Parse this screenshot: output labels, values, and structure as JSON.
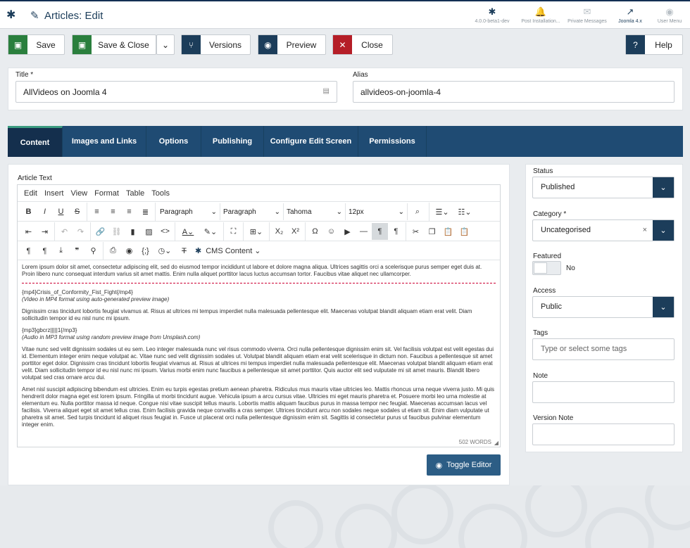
{
  "header": {
    "title": "Articles: Edit",
    "items": [
      {
        "label": "4.0.0-beta1-dev",
        "icon": "joomla-icon"
      },
      {
        "label": "Post Installation...",
        "icon": "bell-icon"
      },
      {
        "label": "Private Messages",
        "icon": "envelope-icon"
      },
      {
        "label": "Joomla 4.x",
        "icon": "external-link-icon"
      },
      {
        "label": "User Menu",
        "icon": "user-icon"
      }
    ]
  },
  "toolbar": {
    "save": "Save",
    "save_close": "Save & Close",
    "versions": "Versions",
    "preview": "Preview",
    "close": "Close",
    "help": "Help"
  },
  "form": {
    "title_label": "Title *",
    "title_value": "AllVideos on Joomla 4",
    "alias_label": "Alias",
    "alias_value": "allvideos-on-joomla-4"
  },
  "tabs": [
    "Content",
    "Images and Links",
    "Options",
    "Publishing",
    "Configure Edit Screen",
    "Permissions"
  ],
  "editor": {
    "label": "Article Text",
    "menu": [
      "Edit",
      "Insert",
      "View",
      "Format",
      "Table",
      "Tools"
    ],
    "selects": [
      "Paragraph",
      "Paragraph",
      "Tahoma",
      "12px"
    ],
    "cms_content": "CMS Content",
    "word_count": "502 WORDS",
    "toggle": "Toggle Editor",
    "paragraphs": [
      "Lorem ipsum dolor sit amet, consectetur adipiscing elit, sed do eiusmod tempor incididunt ut labore et dolore magna aliqua. Ultrices sagittis orci a scelerisque purus semper eget duis at. Proin libero nunc consequat interdum varius sit amet mattis. Enim nulla aliquet porttitor lacus luctus accumsan tortor. Faucibus vitae aliquet nec ullamcorper.",
      "{mp4}Crisis_of_Conformity_Fist_Fight{/mp4}",
      "(Video in MP4 format using auto-generated preview image)",
      "Dignissim cras tincidunt lobortis feugiat vivamus at. Risus at ultrices mi tempus imperdiet nulla malesuada pellentesque elit. Maecenas volutpat blandit aliquam etiam erat velit. Diam sollicitudin tempor id eu nisl nunc mi ipsum.",
      "{mp3}gbcrz|||||1{/mp3}",
      "(Audio in MP3 format using random preview image from Unsplash.com)",
      "Vitae nunc sed velit dignissim sodales ut eu sem. Leo integer malesuada nunc vel risus commodo viverra. Orci nulla pellentesque dignissim enim sit. Vel facilisis volutpat est velit egestas dui id. Elementum integer enim neque volutpat ac. Vitae nunc sed velit dignissim sodales ut. Volutpat blandit aliquam etiam erat velit scelerisque in dictum non. Faucibus a pellentesque sit amet porttitor eget dolor. Dignissim cras tincidunt lobortis feugiat vivamus at. Risus at ultrices mi tempus imperdiet nulla malesuada pellentesque elit. Maecenas volutpat blandit aliquam etiam erat velit. Diam sollicitudin tempor id eu nisl nunc mi ipsum. Varius morbi enim nunc faucibus a pellentesque sit amet porttitor. Quis auctor elit sed vulputate mi sit amet mauris. Blandit libero volutpat sed cras ornare arcu dui.",
      "Amet nisl suscipit adipiscing bibendum est ultricies. Enim eu turpis egestas pretium aenean pharetra. Ridiculus mus mauris vitae ultricies leo. Mattis rhoncus urna neque viverra justo. Mi quis hendrerit dolor magna eget est lorem ipsum. Fringilla ut morbi tincidunt augue. Vehicula ipsum a arcu cursus vitae. Ultricies mi eget mauris pharetra et. Posuere morbi leo urna molestie at elementum eu. Nulla porttitor massa id neque. Congue nisi vitae suscipit tellus mauris. Lobortis mattis aliquam faucibus purus in massa tempor nec feugiat. Maecenas accumsan lacus vel facilisis. Viverra aliquet eget sit amet tellus cras. Enim facilisis gravida neque convallis a cras semper. Ultrices tincidunt arcu non sodales neque sodales ut etiam sit. Enim diam vulputate ut pharetra sit amet. Sed turpis tincidunt id aliquet risus feugiat in. Fusce ut placerat orci nulla pellentesque dignissim enim sit. Sagittis id consectetur purus ut faucibus pulvinar elementum integer enim."
    ]
  },
  "sidebar": {
    "status_label": "Status",
    "status_value": "Published",
    "category_label": "Category *",
    "category_value": "Uncategorised",
    "featured_label": "Featured",
    "featured_value": "No",
    "access_label": "Access",
    "access_value": "Public",
    "tags_label": "Tags",
    "tags_placeholder": "Type or select some tags",
    "note_label": "Note",
    "version_note_label": "Version Note"
  }
}
